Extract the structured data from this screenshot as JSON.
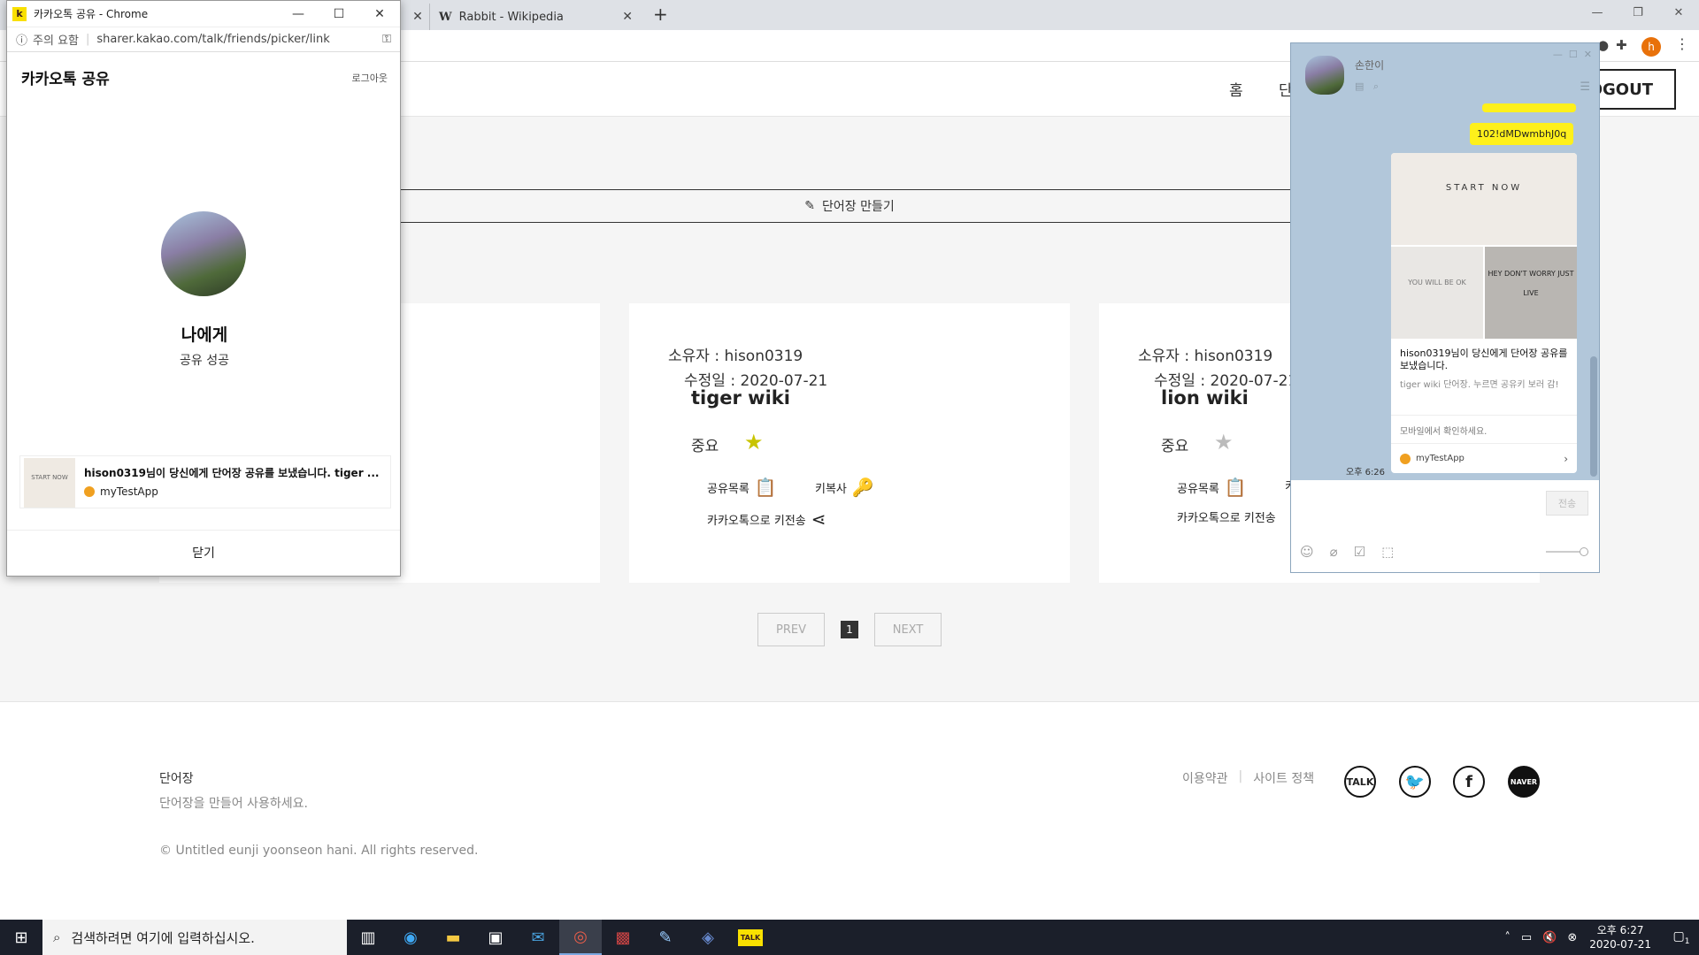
{
  "browser": {
    "tabs": [
      {
        "label": "Rabbit - Wikipedia",
        "icon": "wikipedia-w-icon"
      }
    ],
    "new_tab": "+",
    "profile_initial": "h"
  },
  "site": {
    "nav": {
      "home": "홈",
      "partial": "단",
      "logout": "OGOUT"
    },
    "make_wordbook": "단어장 만들기",
    "cards": [
      {
        "owner": "소유자 : hison0319",
        "modified": "수정일 : 2020-07-21",
        "title": "tiger wiki",
        "importance": "중요",
        "starred": true,
        "share_list": "공유목록",
        "key_copy": "키복사",
        "kakao_send": "카카오톡으로 키전송"
      },
      {
        "owner": "소유자 : hison0319",
        "modified": "수정일 : 2020-07-21",
        "title": "lion wiki",
        "importance": "중요",
        "starred": false,
        "share_list": "공유목록",
        "key_copy": "키",
        "kakao_send": "카카오톡으로 키전송"
      }
    ],
    "pager": {
      "prev": "PREV",
      "current": "1",
      "next": "NEXT"
    },
    "footer": {
      "title": "단어장",
      "description": "단어장을 만들어 사용하세요.",
      "copyright": "© Untitled eunji yoonseon hani. All rights reserved.",
      "links": [
        "이용약관",
        "사이트 정책"
      ],
      "social": [
        "TALK",
        "twitter",
        "facebook",
        "NAVER"
      ]
    }
  },
  "popup": {
    "window_title": "카카오톡 공유 - Chrome",
    "favicon": "k",
    "security": "주의 요함",
    "url": "sharer.kakao.com/talk/friends/picker/link",
    "heading": "카카오톡 공유",
    "logout": "로그아웃",
    "recipient": "나에게",
    "status": "공유 성공",
    "message": "hison0319님이 당신에게 단어장 공유를 보냈습니다. tiger ...",
    "thumb_text": "START NOW",
    "app": "myTestApp",
    "close": "닫기"
  },
  "chat": {
    "name": "손한이",
    "code_bubble": "102!dMDwmbhJ0q",
    "card_img_text": "START NOW",
    "card_img2_text": "YOU WILL BE OK",
    "card_img3_text": "HEY DON'T WORRY JUST LIVE",
    "card_title": "hison0319님이 당신에게 단어장 공유를 보냈습니다.",
    "card_desc": "tiger wiki 단어장. 누르면 공유키 보러 감!",
    "mobile_notice": "모바일에서 확인하세요.",
    "app": "myTestApp",
    "time": "오후 6:26",
    "send": "전송"
  },
  "taskbar": {
    "search_placeholder": "검색하려면 여기에 입력하십시오.",
    "apps": [
      "task-view-icon",
      "edge-icon",
      "explorer-icon",
      "store-icon",
      "mail-icon",
      "chrome-icon",
      "game-icon",
      "paint-icon",
      "vs-icon",
      "kakaotalk-icon"
    ],
    "kakao_label": "TALK",
    "time": "오후 6:27",
    "date": "2020-07-21",
    "notification_count": "1"
  }
}
